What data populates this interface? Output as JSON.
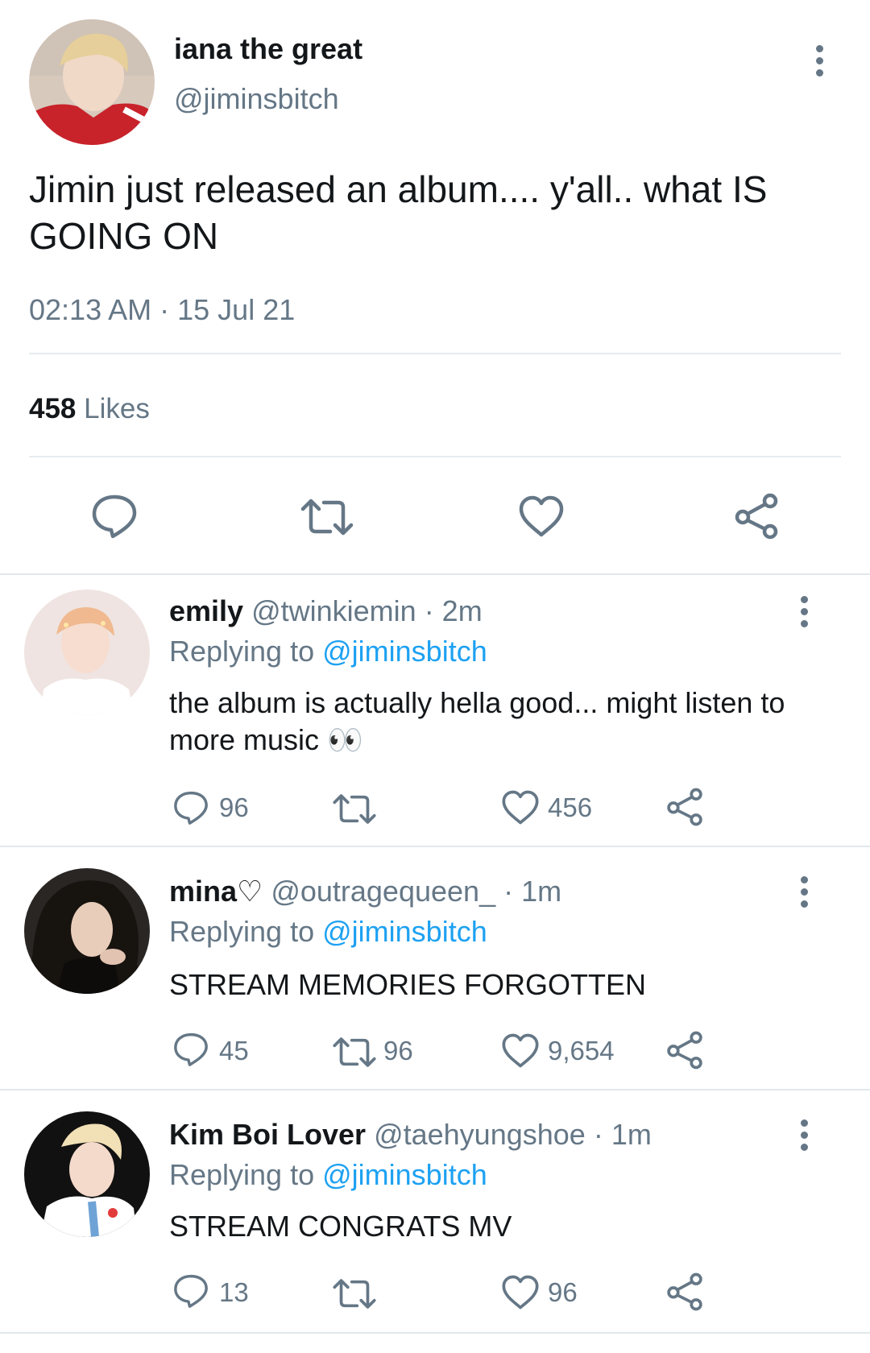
{
  "main_tweet": {
    "display_name": "iana the great",
    "handle": "@jiminsbitch",
    "text": "Jimin just released an album.... y'all.. what IS GOING ON",
    "time": "02:13 AM",
    "separator": "·",
    "date": "15 Jul 21",
    "likes_count": "458",
    "likes_label": "Likes",
    "icons": [
      "reply-icon",
      "retweet-icon",
      "like-icon",
      "share-icon"
    ]
  },
  "replies": [
    {
      "display_name": "emily",
      "handle": "@twinkiemin",
      "time": "· 2m",
      "replying_label": "Replying to",
      "replying_handle": "@jiminsbitch",
      "text": "the album is actually hella good... might listen to more music 👀",
      "reply_count": "96",
      "retweet_count": "",
      "like_count": "456"
    },
    {
      "display_name": "mina♡",
      "handle": "@outragequeen_",
      "time": "· 1m",
      "replying_label": "Replying to",
      "replying_handle": "@jiminsbitch",
      "text": "STREAM MEMORIES FORGOTTEN",
      "reply_count": "45",
      "retweet_count": "96",
      "like_count": "9,654"
    },
    {
      "display_name": "Kim Boi Lover",
      "handle": "@taehyungshoe",
      "time": "· 1m",
      "replying_label": "Replying to",
      "replying_handle": "@jiminsbitch",
      "text": "STREAM CONGRATS MV",
      "reply_count": "13",
      "retweet_count": "",
      "like_count": "96"
    }
  ],
  "colors": {
    "text": "#14171a",
    "muted": "#657786",
    "link": "#1da1f2",
    "divider": "#e6ecf0"
  }
}
